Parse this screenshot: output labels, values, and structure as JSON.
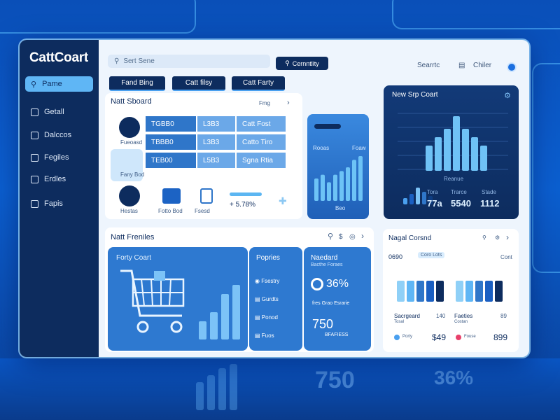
{
  "app": {
    "title": "CattCoart"
  },
  "sidebar": {
    "active": {
      "label": "Pame",
      "icon": "search-icon"
    },
    "items": [
      {
        "label": "Getall",
        "icon": "grid-icon"
      },
      {
        "label": "Dalccos",
        "icon": "docs-icon"
      },
      {
        "label": "Fegiles",
        "icon": "files-icon"
      },
      {
        "label": "Erdles",
        "icon": "list-icon"
      },
      {
        "label": "Fapis",
        "icon": "chart-icon"
      }
    ]
  },
  "header": {
    "search_placeholder": "Sert Sene",
    "center_button": "Cernntlity",
    "search_label": "Searrtc",
    "user_name": "Chiler"
  },
  "tabs": [
    "Fand Bing",
    "Catt filsy",
    "Catt Farty"
  ],
  "shboard": {
    "title": "Natt Sboard",
    "link": "Fmg",
    "left_items": [
      "Fueoasd",
      "Fany Bod",
      "Hestas",
      "Fotto Bod",
      "Fsesd"
    ],
    "rows": [
      {
        "code": "TGBB0",
        "mid": "L3B3",
        "right": "Catt Fost"
      },
      {
        "code": "TBBB0",
        "mid": "L3B3",
        "right": "Catto Tiro"
      },
      {
        "code": "TEB00",
        "mid": "L5B3",
        "right": "Sgna Rtia"
      }
    ],
    "percent": "+ 5.78%"
  },
  "mid_chart": {
    "label_a": "Rooas",
    "label_b": "Foaw",
    "caption": "Beo"
  },
  "new_chart": {
    "title": "New Srp Coart",
    "caption": "Reanue",
    "stats": [
      {
        "label": "Tora",
        "value": "77a"
      },
      {
        "label": "Trarce",
        "value": "5540"
      },
      {
        "label": "Stade",
        "value": "1112"
      }
    ]
  },
  "features": {
    "title": "Natt Freniles",
    "cart_panel": "Forty Coart",
    "popular": {
      "title": "Popries",
      "items": [
        "Fsestry",
        "Gurdts",
        "Ponod",
        "Fuos"
      ]
    },
    "metric": {
      "title": "Naedard",
      "subtitle": "Bacthe Foraes",
      "pct": "36%",
      "pct_caption": "fres Grao Esrarie",
      "value": "750",
      "value_caption": "BFAFIESS"
    }
  },
  "right_card": {
    "title": "Nagal Corsnd",
    "id": "0690",
    "chip": "Coro Lots",
    "link": "Cont",
    "left": {
      "label": "Sacrgeard",
      "sub": "Tosal",
      "num": "140",
      "price": "$49",
      "note": "Porty"
    },
    "right": {
      "label": "Faeties",
      "sub": "Costan",
      "num": "89",
      "price": "899",
      "note": "Fouse"
    }
  },
  "chart_data": [
    {
      "type": "bar",
      "name": "mid",
      "values": [
        6,
        7,
        5,
        7,
        8,
        9,
        11,
        12
      ]
    },
    {
      "type": "bar",
      "name": "new",
      "values": [
        6,
        8,
        10,
        13,
        10,
        8,
        6
      ]
    },
    {
      "type": "bar",
      "name": "mini",
      "values": [
        3,
        5,
        8,
        6,
        4
      ]
    },
    {
      "type": "bar",
      "name": "cart",
      "values": [
        2,
        3,
        5,
        6
      ]
    }
  ],
  "colors": {
    "navy": "#0d2c5e",
    "accent": "#5fb6f5",
    "bar": "#5cb6f2"
  }
}
